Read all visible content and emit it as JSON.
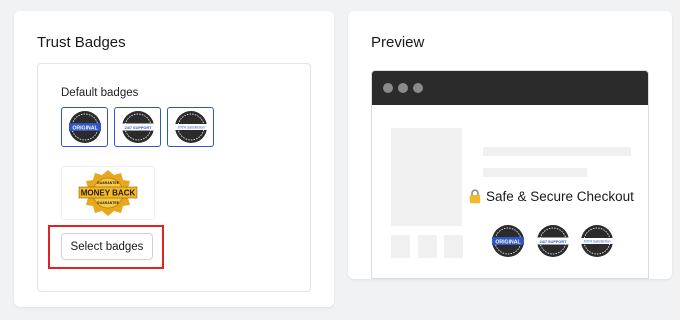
{
  "left_panel": {
    "title": "Trust Badges",
    "default_label": "Default badges",
    "badges": [
      {
        "icon": "original-badge-icon",
        "text": "ORIGINAL"
      },
      {
        "icon": "support-badge-icon",
        "text": "24/7 SUPPORT"
      },
      {
        "icon": "satisfaction-badge-icon",
        "text": "100% Satisfaction"
      }
    ],
    "money_back": {
      "icon": "money-back-badge-icon",
      "text": "MONEY BACK",
      "ribbon_top": "GUARANTEE",
      "ribbon_bottom": "GUARANTEE"
    },
    "select_button": "Select badges"
  },
  "right_panel": {
    "title": "Preview",
    "checkout_icon": "lock-icon",
    "checkout_text": "Safe & Secure Checkout"
  },
  "colors": {
    "accent_blue": "#2f55c6",
    "highlight_red": "#e02424",
    "browser_bar": "#2b2b2b",
    "gold": "#e8a81d"
  }
}
